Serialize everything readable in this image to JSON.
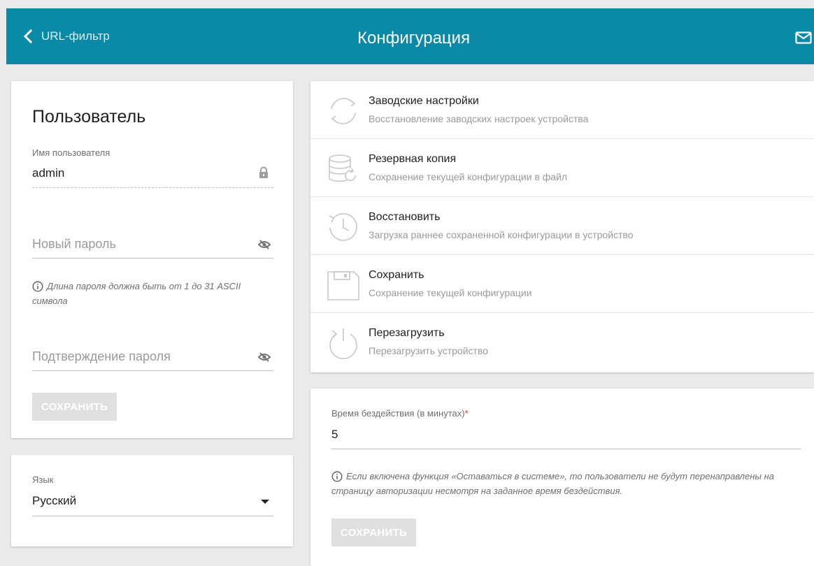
{
  "header": {
    "back_label": "URL-фильтр",
    "title": "Конфигурация"
  },
  "user": {
    "title": "Пользователь",
    "username_label": "Имя пользователя",
    "username_value": "admin",
    "new_password_placeholder": "Новый пароль",
    "password_hint": "Длина пароля должна быть от 1 до 31 ASCII символа",
    "confirm_password_placeholder": "Подтверждение пароля",
    "save_label": "СОХРАНИТЬ"
  },
  "language": {
    "label": "Язык",
    "selected": "Русский"
  },
  "actions": [
    {
      "title": "Заводские настройки",
      "desc": "Восстановление заводских настроек устройства",
      "icon": "factory-reset-icon"
    },
    {
      "title": "Резервная копия",
      "desc": "Сохранение текущей конфигурации в файл",
      "icon": "backup-icon"
    },
    {
      "title": "Восстановить",
      "desc": "Загрузка раннее сохраненной конфигурации в устройство",
      "icon": "restore-icon"
    },
    {
      "title": "Сохранить",
      "desc": "Сохранение текущей конфигурации",
      "icon": "save-icon"
    },
    {
      "title": "Перезагрузить",
      "desc": "Перезагрузить устройство",
      "icon": "reboot-icon"
    }
  ],
  "timeout": {
    "label": "Время бездействия (в минутах)",
    "required_mark": "*",
    "value": "5",
    "hint": "Если включена функция «Оставаться в системе», то пользователи не будут перенаправлены на страницу авторизации несмотря на заданное время бездействия.",
    "save_label": "СОХРАНИТЬ"
  },
  "colors": {
    "header_bg": "#0b8aa8",
    "page_bg": "#ebebeb",
    "disabled_button": "#e0e0e0",
    "required": "#d32f2f"
  }
}
